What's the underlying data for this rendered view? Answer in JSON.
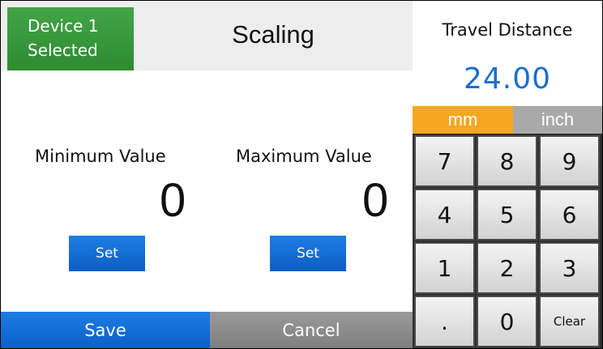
{
  "header": {
    "device_line1": "Device 1",
    "device_line2": "Selected",
    "title": "Scaling"
  },
  "fields": {
    "minimum": {
      "label": "Minimum Value",
      "value": "0",
      "set_label": "Set"
    },
    "maximum": {
      "label": "Maximum Value",
      "value": "0",
      "set_label": "Set"
    }
  },
  "footer": {
    "save_label": "Save",
    "cancel_label": "Cancel"
  },
  "panel": {
    "title": "Travel Distance",
    "value": "24.00",
    "units": [
      "mm",
      "inch"
    ],
    "selected_unit": "mm"
  },
  "keypad": {
    "keys": [
      "7",
      "8",
      "9",
      "4",
      "5",
      "6",
      "1",
      "2",
      "3",
      ".",
      "0",
      "Clear"
    ]
  },
  "colors": {
    "device_badge": "#3a9a3d",
    "accent_blue": "#1a6fd0",
    "unit_selected": "#f5a623",
    "unit_unselected": "#a9a9a9",
    "cancel_gray": "#8c8c8c"
  }
}
